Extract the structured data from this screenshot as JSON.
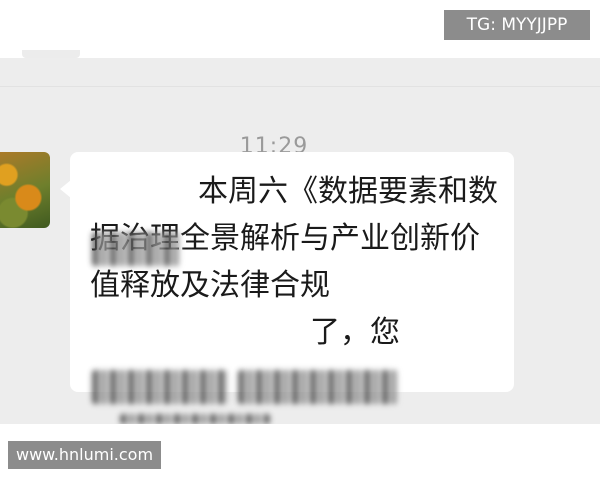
{
  "watermarks": {
    "top": "TG: MYYJJPP",
    "bottom": "www.hnlumi.com"
  },
  "chat": {
    "timestamp": "11:29",
    "message": {
      "sender_avatar": "contact-avatar-photo",
      "text": "本周六《数据要素和数据治理全景解析与产业创新价值释放及法律合规",
      "text_tail": "了，您"
    }
  }
}
